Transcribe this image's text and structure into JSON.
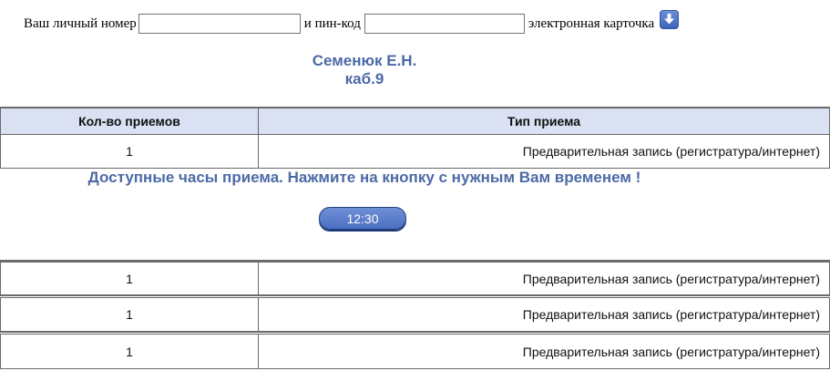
{
  "login": {
    "personal_number_label": "Ваш личный номер",
    "personal_number_value": "",
    "pin_label": "и пин-код",
    "pin_value": "",
    "card_label": "электронная карточка",
    "card_icon": "download-arrow-icon"
  },
  "doctor": {
    "name": "Семенюк Е.Н.",
    "room": "каб.9"
  },
  "table": {
    "headers": [
      "Кол-во приемов",
      "Тип приема"
    ],
    "first_row": {
      "count": "1",
      "type": "Предварительная запись (регистратура/интернет)"
    },
    "rows": [
      {
        "count": "1",
        "type": "Предварительная запись (регистратура/интернет)"
      },
      {
        "count": "1",
        "type": "Предварительная запись (регистратура/интернет)"
      },
      {
        "count": "1",
        "type": "Предварительная запись (регистратура/интернет)"
      }
    ]
  },
  "availability": {
    "message": "Доступные часы приема. Нажмите на кнопку с нужным Вам временем !",
    "slots": [
      "12:30"
    ]
  },
  "colors": {
    "accent": "#4c6aa6",
    "header_bg": "#d9e1f2",
    "button": "#5b7ccb"
  }
}
